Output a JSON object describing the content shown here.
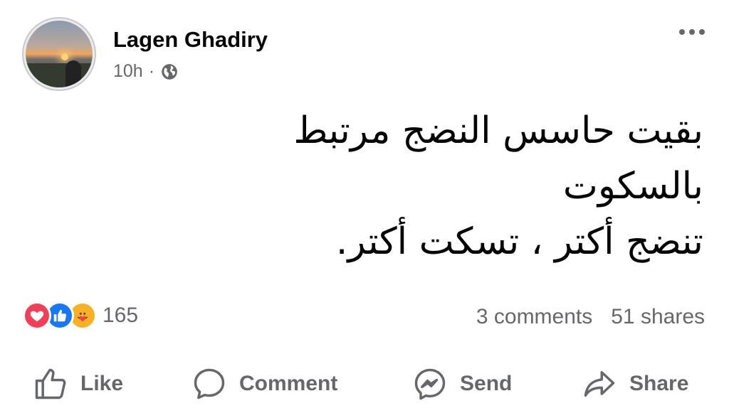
{
  "post": {
    "author": "Lagen Ghadiry",
    "time": "10h",
    "separator": "·",
    "privacy_icon": "globe-icon",
    "text_lines": [
      "بقيت حاسس النضج مرتبط",
      "بالسكوت",
      "تنضج أكتر ، تسكت أكتر."
    ]
  },
  "engagement": {
    "reaction_icons": [
      "love-icon",
      "like-icon",
      "care-icon"
    ],
    "reaction_count": "165",
    "comments": "3 comments",
    "shares": "51 shares"
  },
  "actions": {
    "like": "Like",
    "comment": "Comment",
    "send": "Send",
    "share": "Share"
  },
  "colors": {
    "text": "#050505",
    "secondary": "#65676b",
    "like_blue": "#1877f2",
    "love_red": "#f33e58",
    "care_yellow": "#f7b125"
  }
}
